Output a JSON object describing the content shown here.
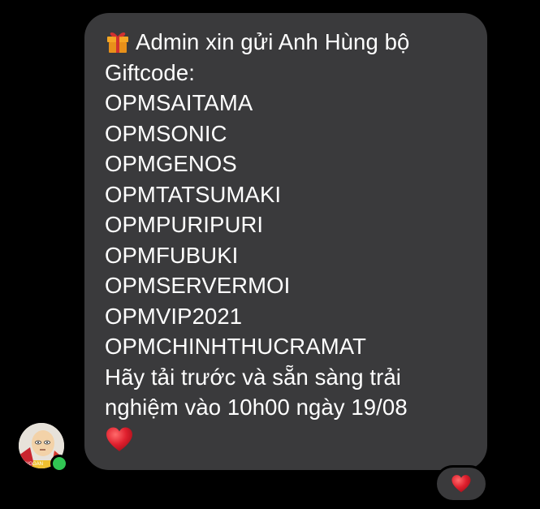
{
  "message": {
    "lines": [
      "Admin xin gửi Anh Hùng bộ",
      "Giftcode:",
      "OPMSAITAMA",
      "OPMSONIC",
      "OPMGENOS",
      "OPMTATSUMAKI",
      "OPMPURIPURI",
      "OPMFUBUKI",
      "OPMSERVERMOI",
      "OPMVIP2021",
      "OPMCHINHTHUCRAMAT",
      "Hãy tải trước và sẵn sàng trải",
      "nghiệm vào 10h00 ngày 19/08"
    ],
    "leading_icon": "gift-icon",
    "trailing_icon": "red-heart-icon"
  },
  "avatar": {
    "icon": "saitama-avatar",
    "badge_text": "VNGGAN",
    "online": true
  },
  "reaction": {
    "icon": "red-heart-icon"
  },
  "colors": {
    "background": "#000000",
    "bubble": "#3a3a3c",
    "text": "#ffffff",
    "heart": "#e0202e",
    "online": "#31c653"
  }
}
